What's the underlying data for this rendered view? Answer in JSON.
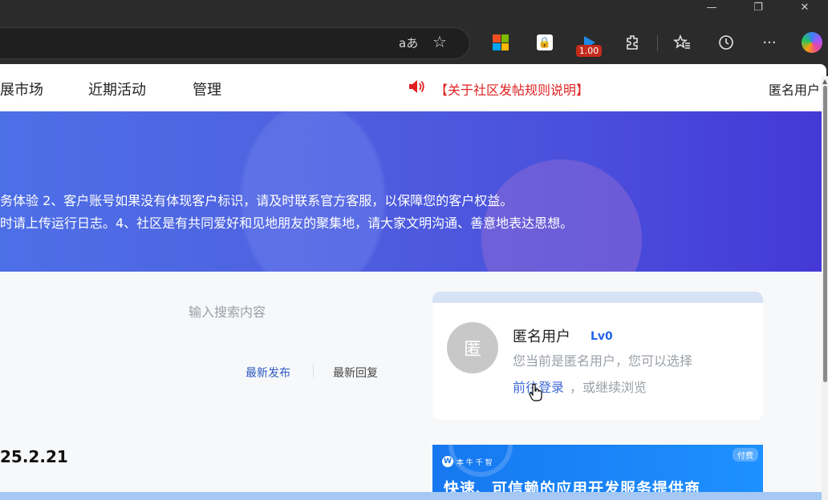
{
  "browser": {
    "controls": {
      "minimize": "—",
      "restore": "❐",
      "close": "✕"
    },
    "address_bar": {
      "read_aloud_label": "aあ"
    },
    "extension_badge": "1.00"
  },
  "nav": {
    "items": [
      "展市场",
      "近期活动",
      "管理"
    ],
    "notice": "【关于社区发帖规则说明】",
    "user": "匿名用户"
  },
  "banner": {
    "lines": [
      "务体验 2、客户账号如果没有体现客户标识，请及时联系官方客服，以保障您的客户权益。",
      "时请上传运行日志。4、社区是有共同爱好和见地朋友的聚集地，请大家文明沟通、善意地表达思想。"
    ]
  },
  "search": {
    "placeholder": "输入搜索内容"
  },
  "sort_tabs": {
    "latest_post": "最新发布",
    "latest_reply": "最新回复"
  },
  "post": {
    "date_fragment": "25.2.21"
  },
  "user_card": {
    "avatar_text": "匿",
    "name": "匿名用户",
    "level": "Lv0",
    "hint": "您当前是匿名用户，您可以选择",
    "login_link": "前往登录",
    "or_browse": "，或继续浏览"
  },
  "ad": {
    "logo_mark": "W",
    "brand": "本 牛 千 智",
    "tag": "付费",
    "title": "快速、可信赖的应用开发服务提供商"
  },
  "colors": {
    "accent_blue": "#3f6bd6",
    "notice_red": "#e02020",
    "level_blue": "#2563eb"
  }
}
